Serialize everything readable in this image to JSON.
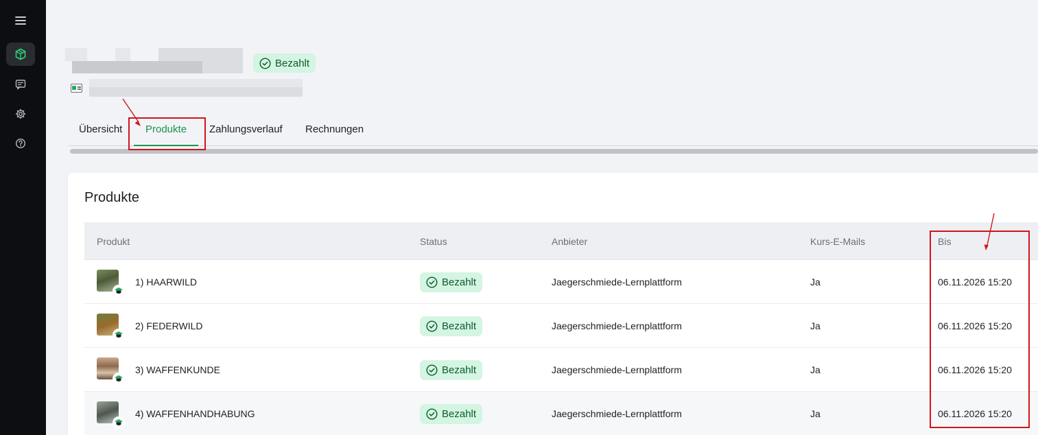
{
  "sidebar": {
    "items": [
      {
        "icon": "menu-icon"
      },
      {
        "icon": "package-icon",
        "active": true
      },
      {
        "icon": "message-icon"
      },
      {
        "icon": "settings-icon"
      },
      {
        "icon": "help-icon"
      }
    ]
  },
  "header": {
    "status_badge": "Bezahlt"
  },
  "tabs": [
    {
      "label": "Übersicht"
    },
    {
      "label": "Produkte",
      "active": true
    },
    {
      "label": "Zahlungsverlauf"
    },
    {
      "label": "Rechnungen"
    }
  ],
  "products": {
    "title": "Produkte",
    "columns": [
      "Produkt",
      "Status",
      "Anbieter",
      "Kurs-E-Mails",
      "Bis"
    ],
    "rows": [
      {
        "name": "1) HAARWILD",
        "status": "Bezahlt",
        "provider": "Jaegerschmiede-Lernplattform",
        "emails": "Ja",
        "until": "06.11.2026 15:20"
      },
      {
        "name": "2) FEDERWILD",
        "status": "Bezahlt",
        "provider": "Jaegerschmiede-Lernplattform",
        "emails": "Ja",
        "until": "06.11.2026 15:20"
      },
      {
        "name": "3) WAFFENKUNDE",
        "status": "Bezahlt",
        "provider": "Jaegerschmiede-Lernplattform",
        "emails": "Ja",
        "until": "06.11.2026 15:20"
      },
      {
        "name": "4) WAFFENHANDHABUNG",
        "status": "Bezahlt",
        "provider": "Jaegerschmiede-Lernplattform",
        "emails": "Ja",
        "until": "06.11.2026 15:20"
      }
    ]
  },
  "colors": {
    "accent": "#17944a",
    "badge_bg": "#d3f5e1",
    "annotation": "#d0141a",
    "sidebar_bg": "#0d0e12"
  }
}
